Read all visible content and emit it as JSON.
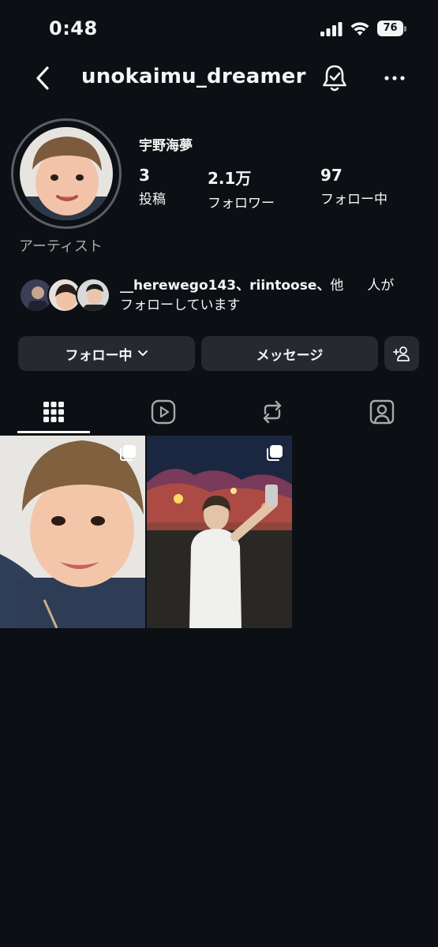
{
  "status_bar": {
    "time": "0:48",
    "battery": "76"
  },
  "header": {
    "username": "unokaimu_dreamer"
  },
  "profile": {
    "display_name": "宇野海夢",
    "category": "アーティスト",
    "stats": [
      {
        "value": "3",
        "label": "投稿"
      },
      {
        "value": "2.1万",
        "label": "フォロワー"
      },
      {
        "value": "97",
        "label": "フォロー中"
      }
    ],
    "mutual": {
      "names": "__herewego143、riintoose、",
      "rest_line1": "他",
      "suffix_line1": "人が",
      "line2": "フォローしています"
    }
  },
  "actions": {
    "following_label": "フォロー中",
    "message_label": "メッセージ"
  },
  "tabs": [
    "grid",
    "reels",
    "reposts",
    "tagged"
  ],
  "posts": [
    {
      "type": "multi-photo",
      "subject": "child-portrait"
    },
    {
      "type": "multi-photo",
      "subject": "night-festival"
    }
  ],
  "colors": {
    "background": "#0c1014",
    "button": "#262a30",
    "secondary_text": "#a8a8a8"
  }
}
